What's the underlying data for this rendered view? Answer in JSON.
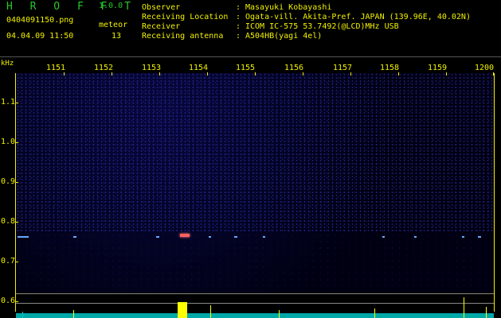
{
  "header": {
    "app_name": "H R O F F T",
    "version": "1.0.0",
    "filename": "0404091150.png",
    "datetime": "04.04.09 11:50",
    "meteor_label": "meteor",
    "meteor_count": "13"
  },
  "info": [
    {
      "label": "Observer",
      "value": "Masayuki Kobayashi"
    },
    {
      "label": "Receiving Location",
      "value": "Ogata-vill. Akita-Pref. JAPAN (139.96E, 40.02N)"
    },
    {
      "label": "Receiver",
      "value": "ICOM IC-575 53.7492(@LCD)MHz USB"
    },
    {
      "label": "Receiving antenna",
      "value": "A504HB(yagi 4el)"
    }
  ],
  "separator": ":",
  "axis": {
    "unit": "kHz",
    "time_ticks": [
      "1151",
      "1152",
      "1153",
      "1154",
      "1155",
      "1156",
      "1157",
      "1158",
      "1159",
      "1200"
    ],
    "freq_ticks": [
      "1.1",
      "1.0",
      "0.9",
      "0.8",
      "0.7",
      "0.6"
    ]
  },
  "colors": {
    "label": "#f0f000",
    "title": "#28c828",
    "noise": "#3a3ad0",
    "meteor": "#6aa8ff",
    "meteor_hot": "#ff6060",
    "spectrum": "#00a8a8"
  }
}
